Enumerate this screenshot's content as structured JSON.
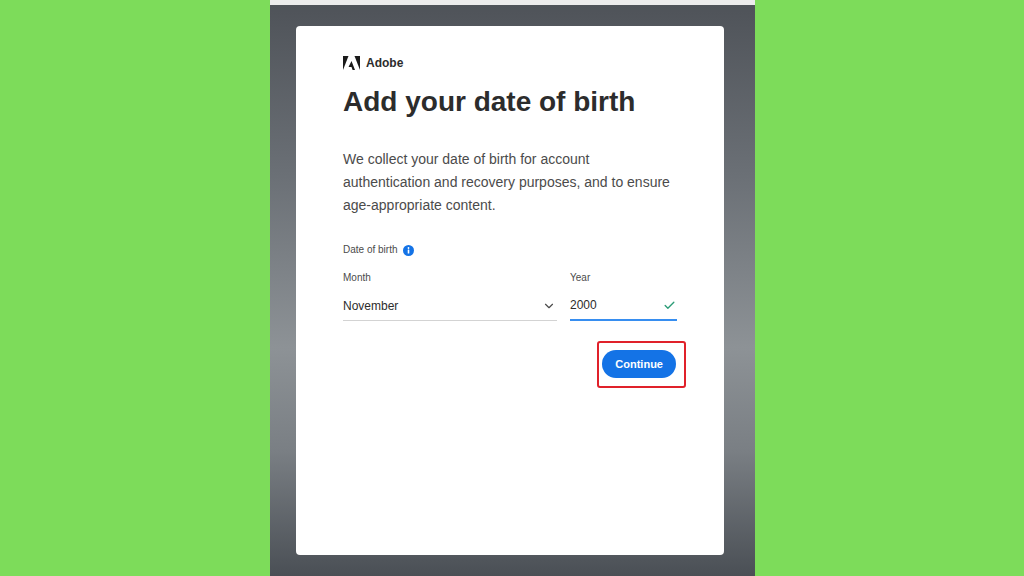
{
  "brand": {
    "name": "Adobe"
  },
  "title": "Add your date of birth",
  "description": "We collect your date of birth for account authentication and recovery purposes, and to ensure age-appropriate content.",
  "date_of_birth": {
    "label": "Date of birth",
    "month": {
      "label": "Month",
      "value": "November"
    },
    "year": {
      "label": "Year",
      "value": "2000",
      "valid": true,
      "focused": true
    }
  },
  "buttons": [
    {
      "label": "Continue",
      "highlighted": true
    }
  ]
}
